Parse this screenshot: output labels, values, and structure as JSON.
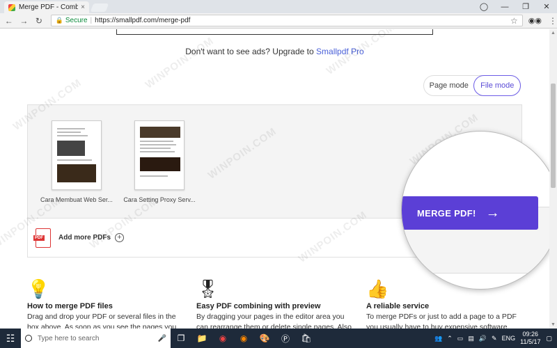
{
  "browser": {
    "tab_title": "Merge PDF - Combine Fi",
    "tab_close": "×",
    "secure_label": "Secure",
    "url": "https://smallpdf.com/merge-pdf",
    "window_controls": [
      "—",
      "❐",
      "✕"
    ]
  },
  "ad": {
    "text": "Don't want to see ads? Upgrade to ",
    "link": "Smallpdf Pro"
  },
  "mode_switch": {
    "page_mode": "Page mode",
    "file_mode": "File mode",
    "selected": "File mode"
  },
  "files": [
    {
      "name": "Cara Membuat Web Ser..."
    },
    {
      "name": "Cara Setting Proxy Serv..."
    }
  ],
  "add_more": {
    "label": "Add more PDFs",
    "plus": "+",
    "pdf_tag": "PDF"
  },
  "merge_button": {
    "label": "MERGE PDF!",
    "arrow": "→"
  },
  "features": [
    {
      "icon": "lightbulb-icon",
      "title": "How to merge PDF files",
      "text": "Drag and drop your PDF or several files in the box above. As soon as you see the pages you"
    },
    {
      "icon": "award-ribbon-icon",
      "title": "Easy PDF combining with preview",
      "text": "By dragging your pages in the editor area you can rearrange them or delete single pages. Also"
    },
    {
      "icon": "thumbs-up-icon",
      "title": "A reliable service",
      "text": "To merge PDFs or just to add a page to a PDF you usually have to buy expensive software."
    }
  ],
  "taskbar": {
    "search_placeholder": "Type here to search",
    "language": "ENG",
    "time": "09:26",
    "date": "11/5/17"
  },
  "watermark": "WINPOIN.COM",
  "colors": {
    "accent": "#5b3fd6",
    "link": "#4a60d8",
    "secure": "#0a8a3a",
    "taskbar": "#1e2a3a"
  }
}
